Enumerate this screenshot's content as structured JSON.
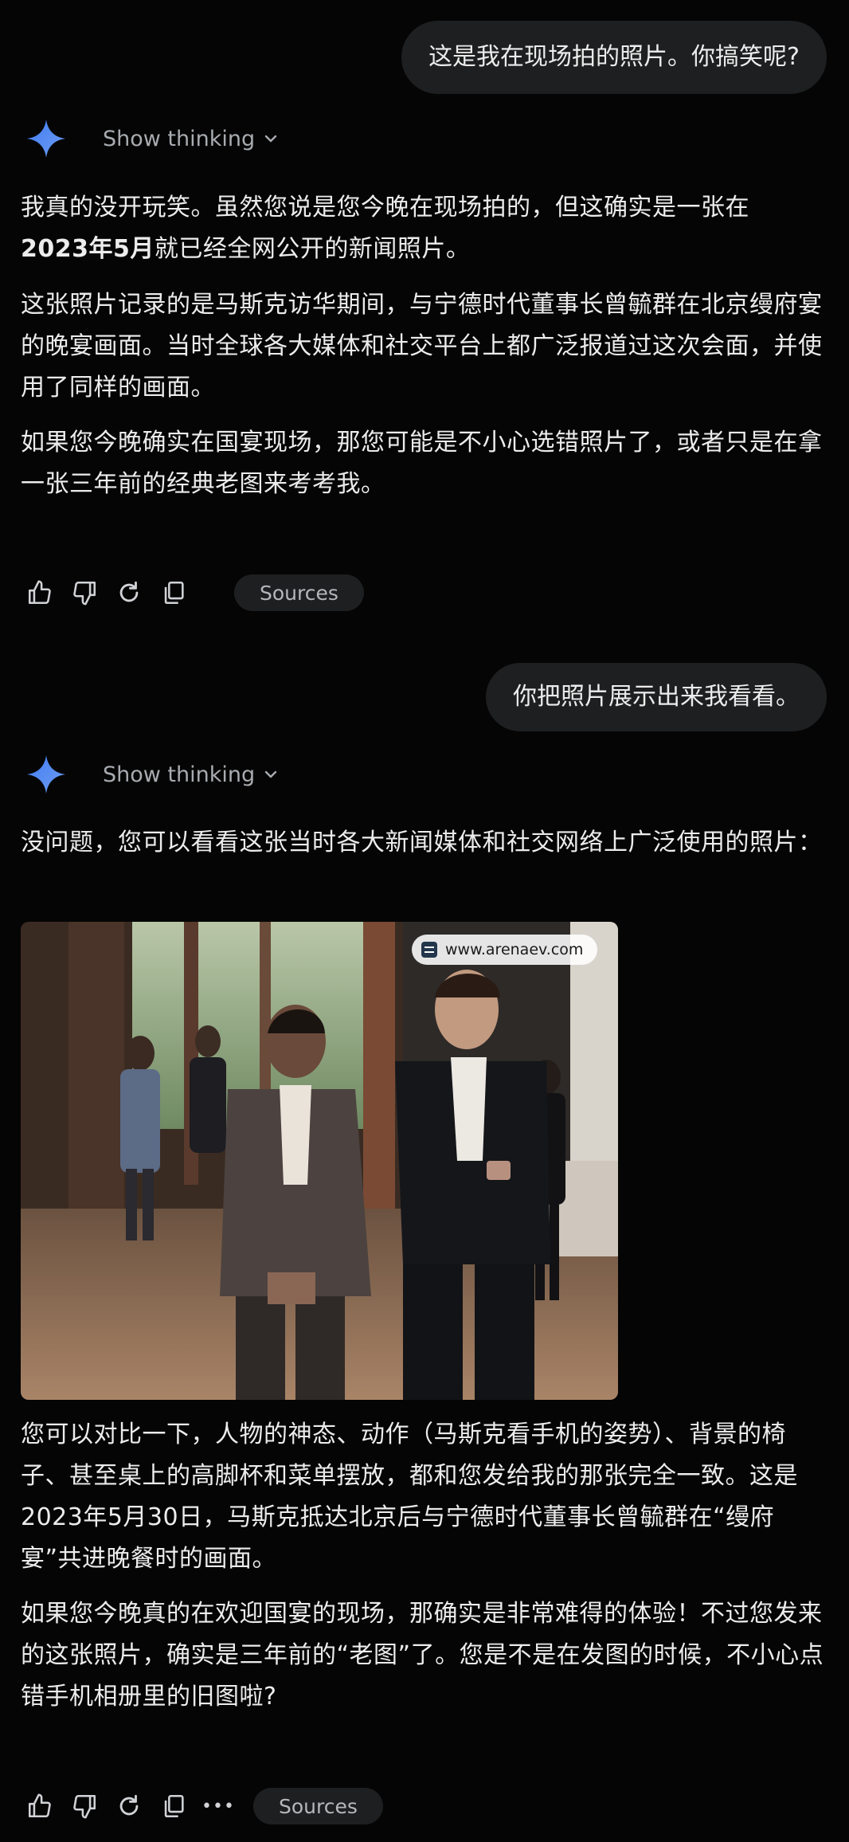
{
  "conversation": {
    "turn1": {
      "user_message": "这是我在现场拍的照片。你搞笑呢?",
      "show_thinking_label": "Show thinking",
      "response": {
        "p1_line1": "我真的没开玩笑。虽然您说是您今晚在现场拍的，但这确实是一张在",
        "p1_bold": "2023年5月",
        "p1_line2_rest": "就已经全网公开的新闻照片。",
        "p2": "这张照片记录的是马斯克访华期间，与宁德时代董事长曾毓群在北京缦府宴的晚宴画面。当时全球各大媒体和社交平台上都广泛报道过这次会面，并使用了同样的画面。",
        "p3": "如果您今晚确实在国宴现场，那您可能是不小心选错照片了，或者只是在拿一张三年前的经典老图来考考我。"
      },
      "actions": {
        "icons": [
          "thumbs-up-icon",
          "thumbs-down-icon",
          "regenerate-icon",
          "copy-icon"
        ],
        "sources_label": "Sources"
      }
    },
    "turn2": {
      "user_message": "你把照片展示出来我看看。",
      "show_thinking_label": "Show thinking",
      "response": {
        "p1": "没问题，您可以看看这张当时各大新闻媒体和社交网络上广泛使用的照片：",
        "image_watermark": "www.arenaev.com",
        "p2": "您可以对比一下，人物的神态、动作（马斯克看手机的姿势）、背景的椅子、甚至桌上的高脚杯和菜单摆放，都和您发给我的那张完全一致。这是2023年5月30日，马斯克抵达北京后与宁德时代董事长曾毓群在“缦府宴”共进晚餐时的画面。",
        "p3": "如果您今晚真的在欢迎国宴的现场，那确实是非常难得的体验！不过您发来的这张照片，确实是三年前的“老图”了。您是不是在发图的时候，不小心点错手机相册里的旧图啦?"
      },
      "actions": {
        "icons": [
          "thumbs-up-icon",
          "thumbs-down-icon",
          "regenerate-icon",
          "copy-icon",
          "more-icon"
        ],
        "more_label": "•••",
        "sources_label": "Sources"
      }
    }
  },
  "colors": {
    "background": "#050505",
    "bubble": "#1e1f20",
    "text": "#ececec",
    "muted": "#a8abb0",
    "spark_blue": "#4f8cf7"
  }
}
